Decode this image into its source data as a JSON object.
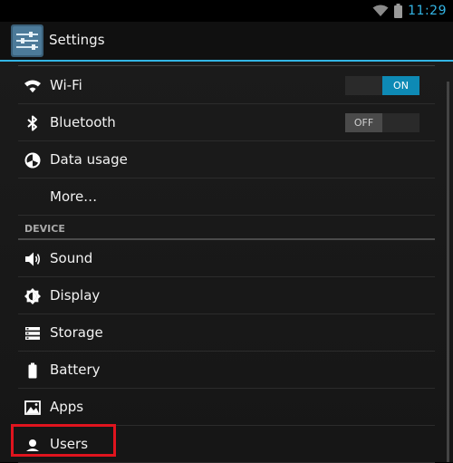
{
  "status_bar": {
    "time": "11:29",
    "icons": [
      "wifi-icon",
      "battery-icon"
    ]
  },
  "action_bar": {
    "title": "Settings",
    "icon": "settings-icon"
  },
  "settings": {
    "wireless": [
      {
        "label": "Wi-Fi",
        "icon": "wifi-icon",
        "toggle": "ON"
      },
      {
        "label": "Bluetooth",
        "icon": "bluetooth-icon",
        "toggle": "OFF"
      },
      {
        "label": "Data usage",
        "icon": "data-usage-icon"
      },
      {
        "label": "More…"
      }
    ],
    "device_header": "DEVICE",
    "device": [
      {
        "label": "Sound",
        "icon": "sound-icon"
      },
      {
        "label": "Display",
        "icon": "display-icon"
      },
      {
        "label": "Storage",
        "icon": "storage-icon"
      },
      {
        "label": "Battery",
        "icon": "battery-icon"
      },
      {
        "label": "Apps",
        "icon": "apps-icon"
      },
      {
        "label": "Users",
        "icon": "users-icon"
      }
    ]
  },
  "colors": {
    "accent": "#33b5e5",
    "toggle_on": "#0e8ab5",
    "highlight": "#e0141e"
  }
}
